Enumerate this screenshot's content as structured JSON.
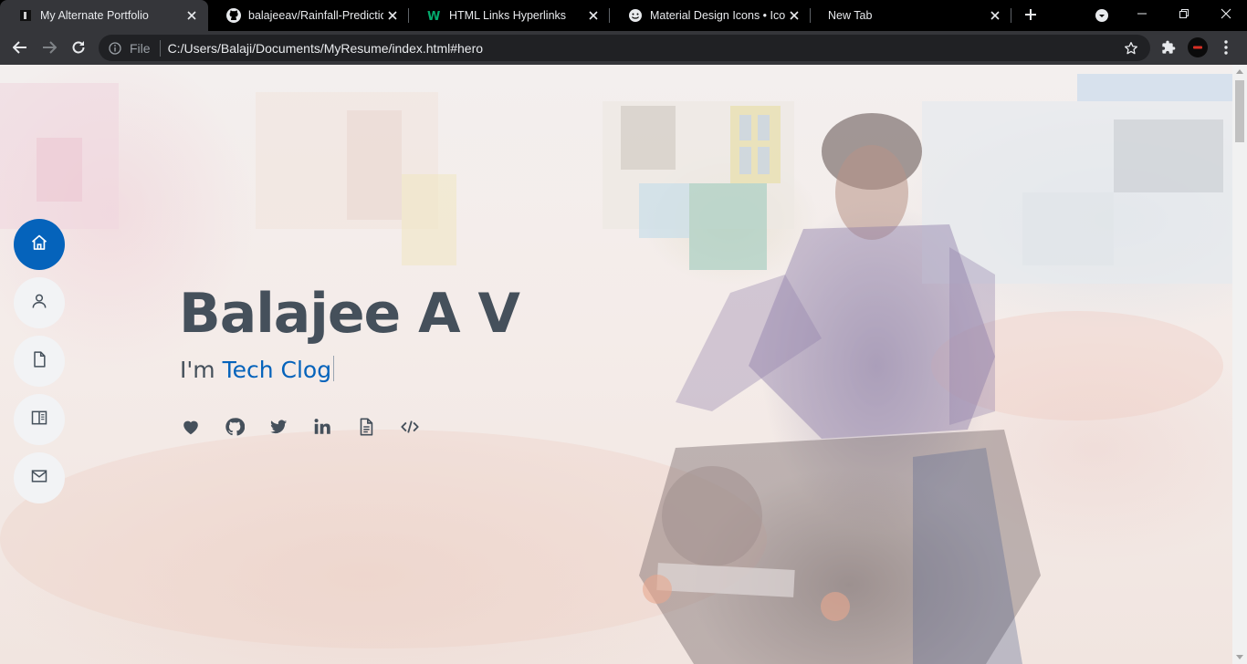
{
  "browser": {
    "tabs": [
      {
        "title": "My Alternate Portfolio",
        "icon": "portfolio-favicon",
        "active": true
      },
      {
        "title": "balajeeav/Rainfall-Prediction",
        "icon": "github-icon",
        "active": false
      },
      {
        "title": "HTML Links Hyperlinks",
        "icon": "w3schools-icon",
        "active": false
      },
      {
        "title": "Material Design Icons • Iconify",
        "icon": "iconify-smiley-icon",
        "active": false
      },
      {
        "title": "New Tab",
        "icon": "",
        "active": false
      }
    ],
    "address": {
      "scheme_label": "File",
      "url": "C:/Users/Balaji/Documents/MyResume/index.html#hero"
    }
  },
  "page": {
    "nav": [
      {
        "name": "home",
        "icon": "home-icon",
        "active": true
      },
      {
        "name": "about",
        "icon": "person-icon",
        "active": false
      },
      {
        "name": "resume",
        "icon": "file-icon",
        "active": false
      },
      {
        "name": "portfolio",
        "icon": "book-open-icon",
        "active": false
      },
      {
        "name": "contact",
        "icon": "envelope-icon",
        "active": false
      }
    ],
    "hero": {
      "name": "Balajee A V",
      "prefix": "I'm",
      "typed": "Tech Clog"
    },
    "social": [
      "heart-icon",
      "github-icon",
      "twitter-icon",
      "linkedin-icon",
      "document-icon",
      "code-icon"
    ],
    "colors": {
      "accent": "#0563bb",
      "heading": "#45505b",
      "nav_bg": "#f2f3f5"
    }
  }
}
